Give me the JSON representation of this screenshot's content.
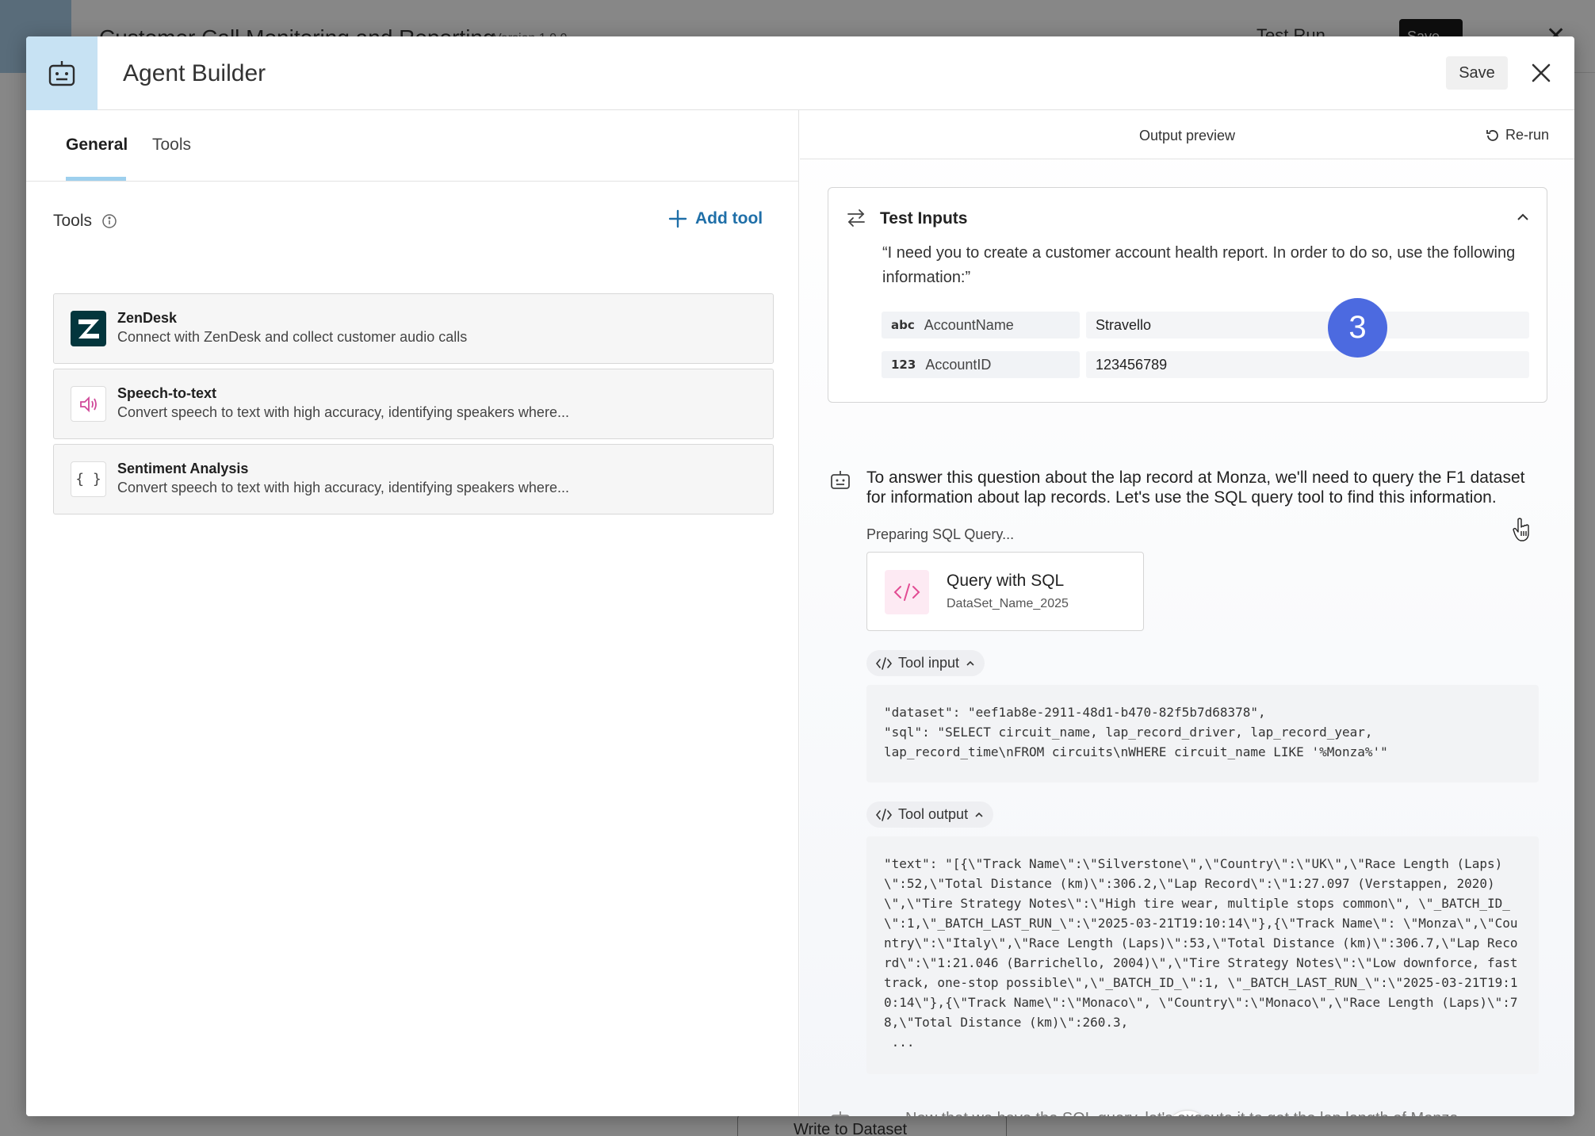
{
  "background_app": {
    "title": "Customer Call Monitoring and Reporting",
    "version": "Version 1.0.0",
    "test_run_label": "Test Run",
    "save_label": "Save",
    "node_label": "Write to Dataset"
  },
  "modal": {
    "title": "Agent Builder",
    "save_label": "Save"
  },
  "left": {
    "tabs": [
      {
        "label": "General",
        "active": true
      },
      {
        "label": "Tools",
        "active": false
      }
    ],
    "tools_label": "Tools",
    "add_tool_label": "Add tool",
    "tools": [
      {
        "name": "ZenDesk",
        "description": "Connect with ZenDesk and collect customer audio calls",
        "icon": "zendesk-logo"
      },
      {
        "name": "Speech-to-text",
        "description": "Convert speech to text with high accuracy, identifying speakers where...",
        "icon": "speaker-icon"
      },
      {
        "name": "Sentiment Analysis",
        "description": "Convert speech to text with high accuracy, identifying speakers where...",
        "icon": "braces-icon"
      }
    ]
  },
  "right": {
    "title": "Output preview",
    "rerun_label": "Re-run",
    "test_inputs": {
      "title": "Test Inputs",
      "prompt": "“I need you to create a customer account health report. In order to do so, use the following information:”",
      "fields": [
        {
          "type": "abc",
          "key": "AccountName",
          "value": "Stravello"
        },
        {
          "type": "123",
          "key": "AccountID",
          "value": "123456789"
        }
      ]
    },
    "step_badge": "3",
    "message": "To answer this question about the lap record at Monza, we'll need to query the F1 dataset for information about lap records. Let's use the SQL query tool to find this information.",
    "preparing": "Preparing SQL Query...",
    "sql_card": {
      "title": "Query with SQL",
      "subtitle": "DataSet_Name_2025"
    },
    "tool_input_label": "Tool input",
    "tool_input_code": "\"dataset\": \"eef1ab8e-2911-48d1-b470-82f5b7d68378\",\n\"sql\": \"SELECT circuit_name, lap_record_driver, lap_record_year,\nlap_record_time\\nFROM circuits\\nWHERE circuit_name LIKE '%Monza%'\"",
    "tool_output_label": "Tool output",
    "tool_output_code": "\"text\": \"[{\\\"Track Name\\\":\\\"Silverstone\\\",\\\"Country\\\":\\\"UK\\\",\\\"Race Length (Laps)\\\":52,\\\"Total Distance (km)\\\":306.2,\\\"Lap Record\\\":\\\"1:27.097 (Verstappen, 2020)\\\",\\\"Tire Strategy Notes\\\":\\\"High tire wear, multiple stops common\\\", \\\"_BATCH_ID_\\\":1,\\\"_BATCH_LAST_RUN_\\\":\\\"2025-03-21T19:10:14\\\"},{\\\"Track Name\\\": \\\"Monza\\\",\\\"Country\\\":\\\"Italy\\\",\\\"Race Length (Laps)\\\":53,\\\"Total Distance (km)\\\":306.7,\\\"Lap Record\\\":\\\"1:21.046 (Barrichello, 2004)\\\",\\\"Tire Strategy Notes\\\":\\\"Low downforce, fast track, one-stop possible\\\",\\\"_BATCH_ID_\\\":1, \\\"_BATCH_LAST_RUN_\\\":\\\"2025-03-21T19:10:14\\\"},{\\\"Track Name\\\":\\\"Monaco\\\", \\\"Country\\\":\\\"Monaco\\\",\\\"Race Length (Laps)\\\":78,\\\"Total Distance (km)\\\":260.3,\n ...",
    "next_message": "Now that we have the SQL query, let's execute it to get the lap length of Monza."
  },
  "colors": {
    "accent_blue": "#1f6fa8",
    "tab_underline": "#9ed0ee",
    "logo_bg": "#c7e2f3",
    "step_badge": "#4c6ae0",
    "sql_icon": "#e24c93",
    "zendesk": "#03363d"
  }
}
